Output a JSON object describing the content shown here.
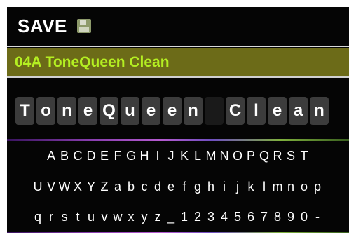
{
  "header": {
    "title": "SAVE",
    "icon": "floppy-disk-icon"
  },
  "preset": {
    "label": "04A  ToneQueen Clean"
  },
  "name_chars": [
    "T",
    "o",
    "n",
    "e",
    "Q",
    "u",
    "e",
    "e",
    "n",
    " ",
    "C",
    "l",
    "e",
    "a",
    "n"
  ],
  "keyboard": {
    "row1": [
      "A",
      "B",
      "C",
      "D",
      "E",
      "F",
      "G",
      "H",
      "I",
      "J",
      "K",
      "L",
      "M",
      "N",
      "O",
      "P",
      "Q",
      "R",
      "S",
      "T"
    ],
    "row2": [
      "U",
      "V",
      "W",
      "X",
      "Y",
      "Z",
      "a",
      "b",
      "c",
      "d",
      "e",
      "f",
      "g",
      "h",
      "i",
      "j",
      "k",
      "l",
      "m",
      "n",
      "o",
      "p"
    ],
    "row3": [
      "q",
      "r",
      "s",
      "t",
      "u",
      "v",
      "w",
      "x",
      "y",
      "z",
      "_",
      "1",
      "2",
      "3",
      "4",
      "5",
      "6",
      "7",
      "8",
      "9",
      "0",
      "-"
    ]
  },
  "colors": {
    "preset_bg": "#6c6b18",
    "preset_text": "#b4ef22",
    "background": "#050505"
  }
}
